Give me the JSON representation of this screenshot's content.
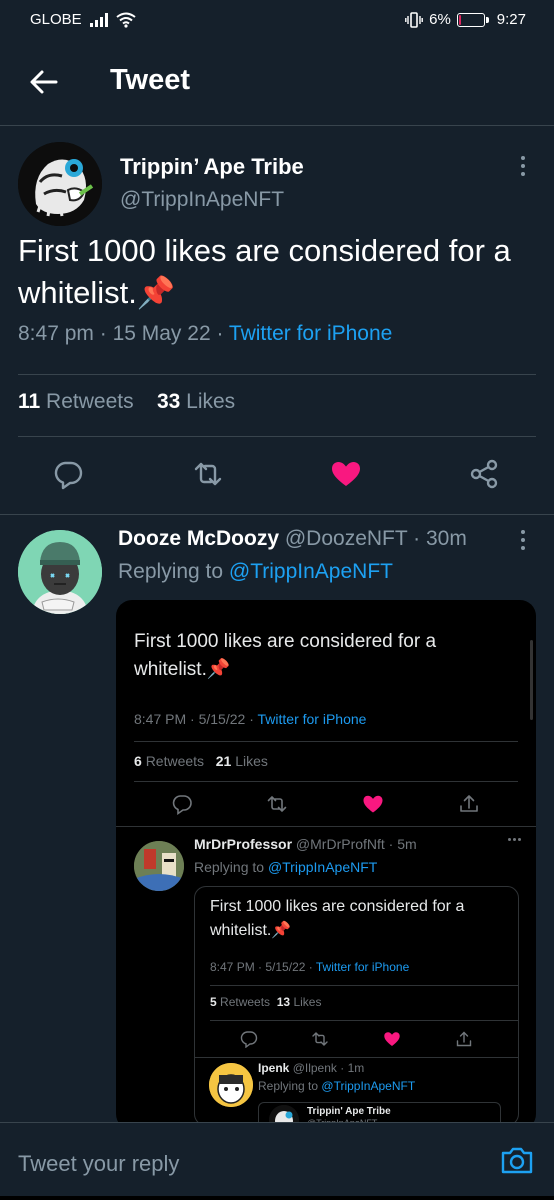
{
  "status_bar": {
    "carrier": "GLOBE",
    "battery_percent": "6%",
    "battery_level": 0.06,
    "time": "9:27"
  },
  "header": {
    "title": "Tweet"
  },
  "main_tweet": {
    "author_name": "Trippin’ Ape Tribe",
    "author_handle": "@TrippInApeNFT",
    "text": "First 1000 likes are considered for a whitelist.📌",
    "time": "8:47 pm",
    "date": "15 May 22",
    "source": "Twitter for iPhone",
    "retweet_count": "11",
    "retweet_label": "Retweets",
    "like_count": "33",
    "like_label": "Likes",
    "liked": true
  },
  "reply": {
    "author_name": "Dooze McDoozy",
    "author_handle": "@DoozeNFT",
    "age": "30m",
    "replying_label": "Replying to",
    "replying_to": "@TrippInApeNFT",
    "screenshot": {
      "text": "First 1000 likes are considered for a whitelist.📌",
      "meta_time": "8:47 PM",
      "meta_date": "5/15/22",
      "meta_source": "Twitter for iPhone",
      "retweet_count": "6",
      "retweet_label": "Retweets",
      "like_count": "21",
      "like_label": "Likes",
      "nested_reply": {
        "author_name": "MrDrProfessor",
        "author_handle": "@MrDrProfNft",
        "age": "5m",
        "replying_label": "Replying to",
        "replying_to": "@TrippInApeNFT",
        "text": "First 1000 likes are considered for a whitelist.📌",
        "meta_time": "8:47 PM",
        "meta_date": "5/15/22",
        "meta_source": "Twitter for iPhone",
        "retweet_count": "5",
        "retweet_label": "Retweets",
        "like_count": "13",
        "like_label": "Likes"
      },
      "nested_reply_2": {
        "author_name": "Ipenk",
        "author_handle": "@Ilpenk",
        "age": "1m",
        "replying_label": "Replying to",
        "replying_to": "@TrippInApeNFT",
        "quoted_name": "Trippin' Ape Tribe",
        "quoted_handle": "@TrippInApeNFT"
      }
    }
  },
  "reply_bar": {
    "placeholder": "Tweet your reply"
  },
  "colors": {
    "background": "#15202b",
    "accent": "#1da1f2",
    "like": "#f91880",
    "muted": "#8899a6",
    "border": "#38444d"
  }
}
